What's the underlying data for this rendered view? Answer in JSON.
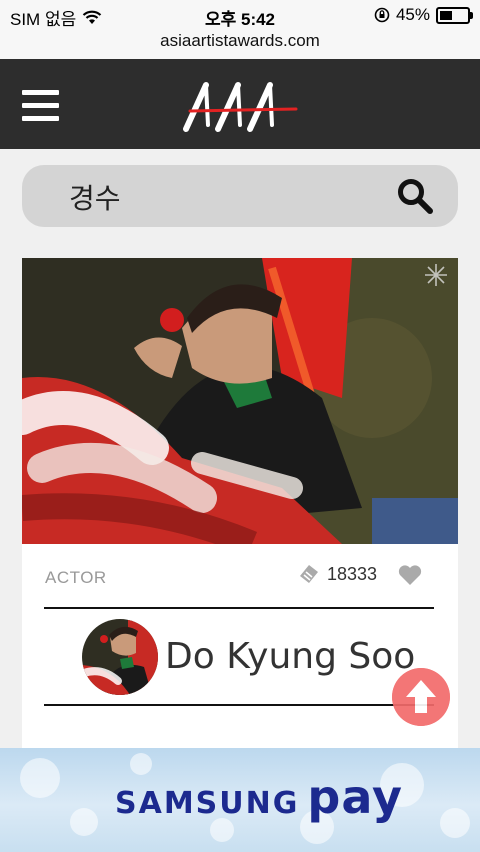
{
  "status": {
    "carrier": "SIM 없음",
    "time": "오후 5:42",
    "battery": "45%"
  },
  "browser": {
    "url": "asiaartistawards.com"
  },
  "search": {
    "value": "경수"
  },
  "card": {
    "category": "ACTOR",
    "votes": "18333",
    "name": "Do Kyung Soo"
  },
  "ad": {
    "brand1": "SAMSUNG",
    "brand2": "pay"
  },
  "colors": {
    "header": "#2d2d2d",
    "accent": "#f26b6b",
    "ad_brand": "#1c2a8f"
  }
}
